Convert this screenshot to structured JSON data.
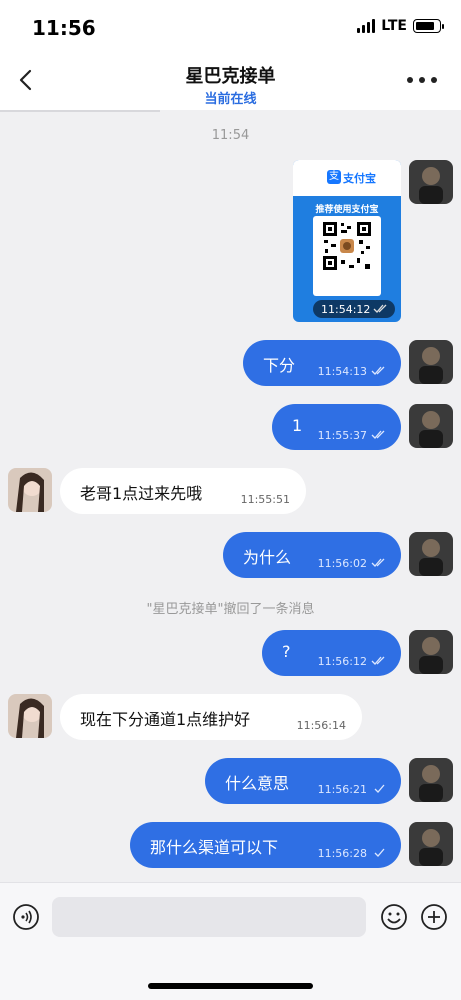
{
  "status_bar": {
    "time": "11:56",
    "network": "LTE",
    "battery_level": 0.8
  },
  "header": {
    "title": "星巴克接单",
    "subtitle": "当前在线"
  },
  "colors": {
    "accent": "#2f6fe4",
    "subtitle": "#2b6de0",
    "background": "#f0f0f2"
  },
  "chat": {
    "timestamp": "11:54",
    "image_message": {
      "brand": "支付宝",
      "brand_icon": "支",
      "caption": "推荐使用支付宝",
      "time": "11:54:12"
    },
    "messages": [
      {
        "dir": "out",
        "text": "下分",
        "time": "11:54:13",
        "status": "read"
      },
      {
        "dir": "out",
        "text": "1",
        "time": "11:55:37",
        "status": "read"
      },
      {
        "dir": "in",
        "text": "老哥1点过来先哦",
        "time": "11:55:51"
      },
      {
        "dir": "out",
        "text": "为什么",
        "time": "11:56:02",
        "status": "read"
      },
      {
        "dir": "out",
        "text": "?",
        "time": "11:56:12",
        "status": "read"
      },
      {
        "dir": "in",
        "text": "现在下分通道1点维护好",
        "time": "11:56:14"
      },
      {
        "dir": "out",
        "text": "什么意思",
        "time": "11:56:21",
        "status": "sent"
      },
      {
        "dir": "out",
        "text": "那什么渠道可以下",
        "time": "11:56:28",
        "status": "sent"
      }
    ],
    "system_message": "\"星巴克接单\"撤回了一条消息"
  },
  "input": {
    "placeholder": ""
  },
  "icons": {
    "back": "chevron-left-icon",
    "more": "more-dots-icon",
    "voice": "voice-icon",
    "emoji": "emoji-icon",
    "plus": "plus-icon"
  }
}
